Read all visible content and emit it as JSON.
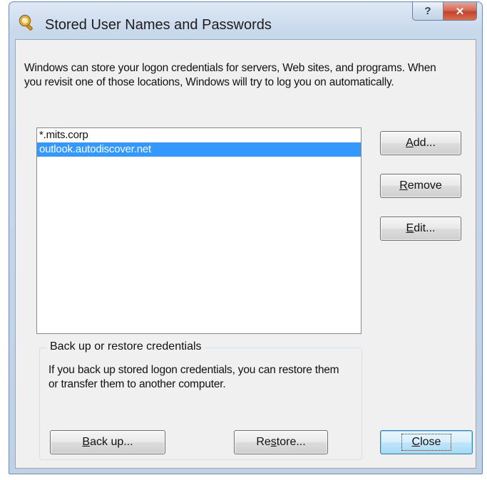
{
  "window": {
    "title": "Stored User Names and Passwords",
    "help_label": "?",
    "close_label": "✕"
  },
  "intro_text": "Windows can store your logon credentials for servers, Web sites, and programs. When you revisit one of those locations, Windows will try to log you on automatically.",
  "credentials": {
    "items": [
      {
        "label": "*.mits.corp",
        "selected": false
      },
      {
        "label": "outlook.autodiscover.net",
        "selected": true
      }
    ]
  },
  "buttons": {
    "add": {
      "pre": "",
      "accel": "A",
      "post": "dd..."
    },
    "remove": {
      "pre": "",
      "accel": "R",
      "post": "emove"
    },
    "edit": {
      "pre": "",
      "accel": "E",
      "post": "dit..."
    },
    "backup": {
      "pre": "",
      "accel": "B",
      "post": "ack up..."
    },
    "restore": {
      "pre": "Re",
      "accel": "s",
      "post": "tore..."
    },
    "close": {
      "pre": "",
      "accel": "C",
      "post": "lose"
    }
  },
  "backup_group": {
    "legend": "Back up or restore credentials",
    "description": "If you back up stored logon credentials, you can restore them or transfer them to another computer."
  },
  "colors": {
    "selection": "#3399ff",
    "dialog_face": "#f0f0f0",
    "close_button_red": "#c2432a"
  },
  "icons": {
    "title": "magnifier-key-icon"
  }
}
